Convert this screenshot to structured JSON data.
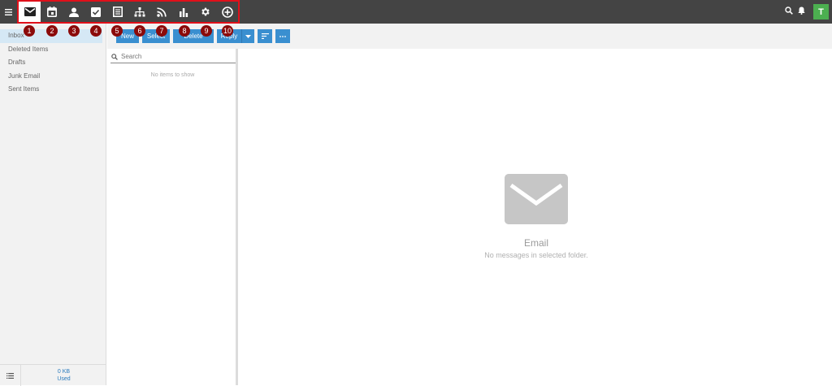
{
  "header": {
    "modules": [
      {
        "icon": "mail-icon",
        "active": true
      },
      {
        "icon": "calendar-icon",
        "active": false
      },
      {
        "icon": "contacts-icon",
        "active": false
      },
      {
        "icon": "tasks-icon",
        "active": false
      },
      {
        "icon": "notes-icon",
        "active": false
      },
      {
        "icon": "org-chart-icon",
        "active": false
      },
      {
        "icon": "rss-icon",
        "active": false
      },
      {
        "icon": "reports-icon",
        "active": false
      },
      {
        "icon": "settings-icon",
        "active": false
      },
      {
        "icon": "add-icon",
        "active": false
      }
    ],
    "avatar_letter": "T",
    "accent_color": "#444444",
    "avatar_color": "#4caf50"
  },
  "badges": [
    "1",
    "2",
    "3",
    "4",
    "5",
    "6",
    "7",
    "8",
    "9",
    "10"
  ],
  "sidebar": {
    "folders": [
      "Inbox",
      "Deleted Items",
      "Drafts",
      "Junk Email",
      "Sent Items"
    ],
    "selected_folder": "Inbox",
    "usage_size": "0 KB",
    "usage_label": "Used"
  },
  "toolbar": {
    "new_label": "New",
    "select_label": "Select",
    "delete_label": "Delete",
    "reply_label": "Reply",
    "button_color": "#3a8fd0"
  },
  "list": {
    "search_placeholder": "Search",
    "empty_text": "No items to show"
  },
  "reading_pane": {
    "title": "Email",
    "subtitle": "No messages in selected folder."
  }
}
